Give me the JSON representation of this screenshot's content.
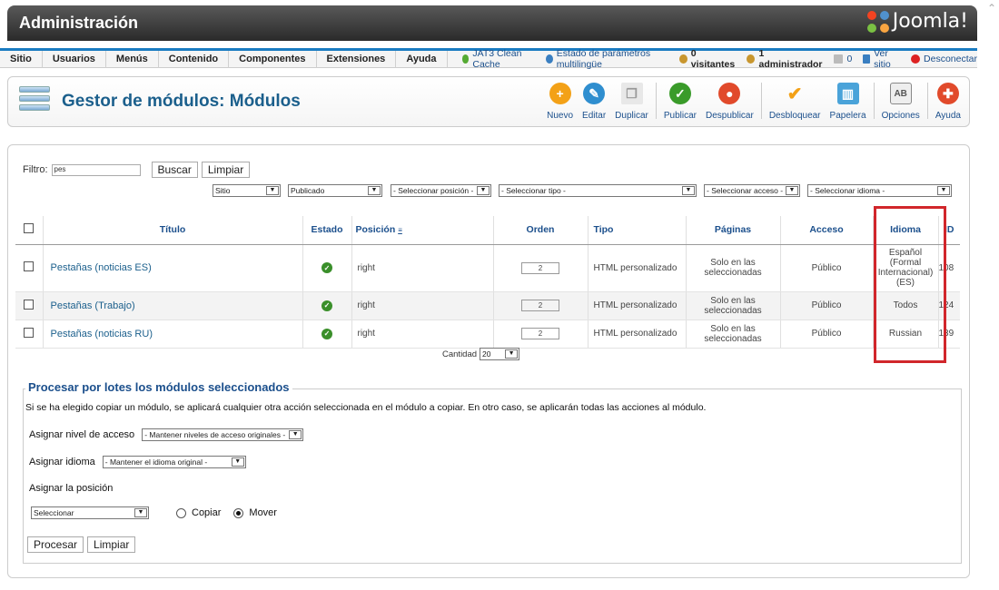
{
  "header": {
    "title": "Administración",
    "logo_text": "Joomla!"
  },
  "menu": [
    "Sitio",
    "Usuarios",
    "Menús",
    "Contenido",
    "Componentes",
    "Extensiones",
    "Ayuda"
  ],
  "status": {
    "cache": "JAT3 Clean Cache",
    "multilang": "Estado de parámetros multilingüe",
    "visitors": "0 visitantes",
    "admins": "1 administrador",
    "messages": "0",
    "view_site": "Ver sitio",
    "logout": "Desconectar"
  },
  "toolbar": {
    "title": "Gestor de módulos: Módulos",
    "buttons": [
      {
        "label": "Nuevo",
        "icon": "plus-icon",
        "color": "#f3a117"
      },
      {
        "label": "Editar",
        "icon": "pencil-icon",
        "color": "#2f8ecf"
      },
      {
        "label": "Duplicar",
        "icon": "copy-icon",
        "color": "#d8d8d8"
      },
      {
        "label": "Publicar",
        "icon": "check-icon",
        "color": "#3a9b2a"
      },
      {
        "label": "Despublicar",
        "icon": "stop-icon",
        "color": "#e14a2b"
      },
      {
        "label": "Desbloquear",
        "icon": "checkin-icon",
        "color": "#f3a117"
      },
      {
        "label": "Papelera",
        "icon": "trash-icon",
        "color": "#4aa3d9"
      },
      {
        "label": "Opciones",
        "icon": "options-icon",
        "color": "#9a9a9a"
      },
      {
        "label": "Ayuda",
        "icon": "help-icon",
        "color": "#e14a2b"
      }
    ]
  },
  "filter": {
    "label": "Filtro:",
    "value": "pes",
    "search_btn": "Buscar",
    "clear_btn": "Limpiar",
    "selects": [
      "Sitio",
      "Publicado",
      "- Seleccionar posición -",
      "- Seleccionar tipo -",
      "- Seleccionar acceso -",
      "- Seleccionar idioma -"
    ]
  },
  "table": {
    "headers": {
      "title": "Título",
      "state": "Estado",
      "position": "Posición",
      "order": "Orden",
      "type": "Tipo",
      "pages": "Páginas",
      "access": "Acceso",
      "language": "Idioma",
      "id": "ID"
    },
    "rows": [
      {
        "title": "Pestañas (noticias ES)",
        "position": "right",
        "order": "2",
        "type": "HTML personalizado",
        "pages": "Solo en las seleccionadas",
        "access": "Público",
        "language": "Español (Formal Internacional) (ES)",
        "id": "108"
      },
      {
        "title": "Pestañas (Trabajo)",
        "position": "right",
        "order": "2",
        "type": "HTML personalizado",
        "pages": "Solo en las seleccionadas",
        "access": "Público",
        "language": "Todos",
        "id": "124"
      },
      {
        "title": "Pestañas (noticias RU)",
        "position": "right",
        "order": "2",
        "type": "HTML personalizado",
        "pages": "Solo en las seleccionadas",
        "access": "Público",
        "language": "Russian",
        "id": "139"
      }
    ],
    "quantity_label": "Cantidad",
    "quantity_value": "20"
  },
  "batch": {
    "legend": "Procesar por lotes los módulos seleccionados",
    "description": "Si se ha elegido copiar un módulo, se aplicará cualquier otra acción seleccionada en el módulo a copiar. En otro caso, se aplicarán todas las acciones al módulo.",
    "access_label": "Asignar nivel de acceso",
    "access_value": "- Mantener niveles de acceso originales -",
    "language_label": "Asignar idioma",
    "language_value": "- Mantener el idioma original -",
    "position_label": "Asignar la posición",
    "position_value": "Seleccionar",
    "copy_label": "Copiar",
    "move_label": "Mover",
    "process_btn": "Procesar",
    "clear_btn": "Limpiar"
  }
}
